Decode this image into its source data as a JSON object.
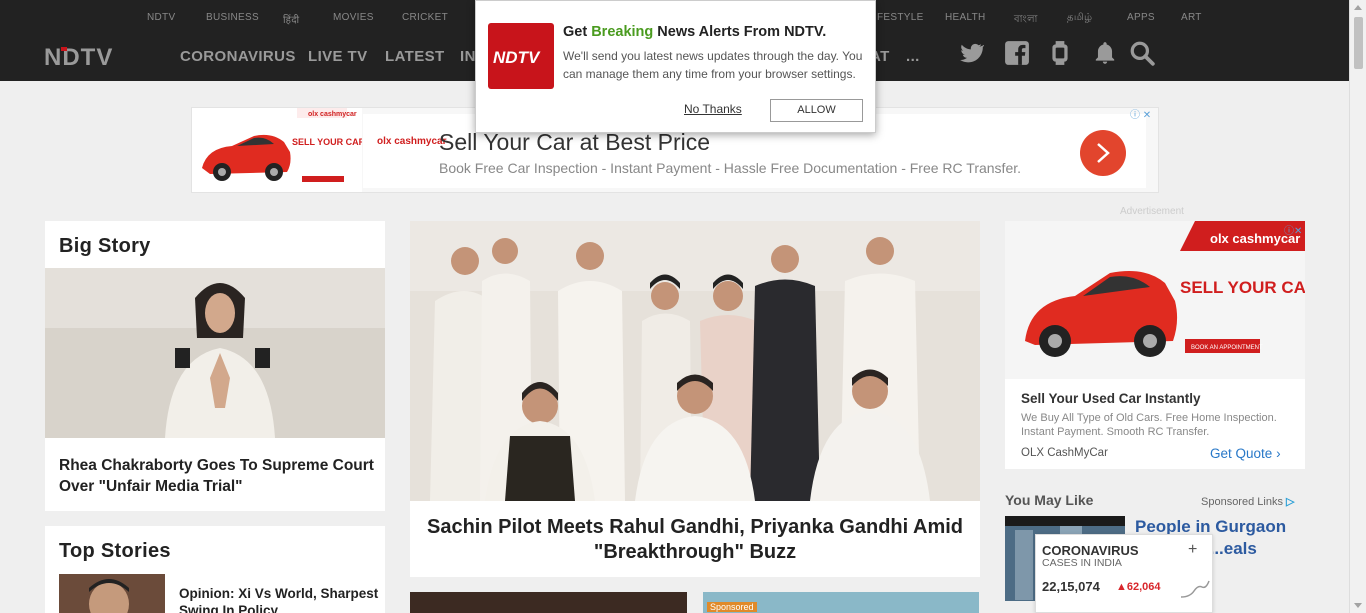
{
  "header": {
    "top_links": [
      "NDTV",
      "BUSINESS",
      "हिंदी",
      "MOVIES",
      "CRICKET",
      "FESTYLE",
      "HEALTH",
      "বাংলা",
      "தமிழ்",
      "APPS",
      "ART"
    ],
    "logo_text": "NDTV",
    "nav": [
      "CORONAVIRUS",
      "LIVE TV",
      "LATEST",
      "IN",
      "AT",
      "..."
    ]
  },
  "popup": {
    "title_pre": "Get ",
    "title_highlight": "Breaking",
    "title_post": " News Alerts From NDTV.",
    "body": "We'll send you latest news updates through the day. You can manage them any time from your browser settings.",
    "logo_text": "NDTV",
    "no_thanks": "No Thanks",
    "allow": "ALLOW"
  },
  "banner_ad": {
    "brand": "olx cashmycar",
    "car_tagline": "SELL YOUR CAR IN ONE VISIT.",
    "headline": "Sell Your Car at Best Price",
    "subline": "Book Free Car Inspection - Instant Payment - Hassle Free Documentation - Free RC Transfer."
  },
  "big_story": {
    "heading": "Big Story",
    "caption": "Rhea Chakraborty Goes To Supreme Court Over \"Unfair Media Trial\""
  },
  "lead_story": {
    "caption": "Sachin Pilot Meets Rahul Gandhi, Priyanka Gandhi Amid \"Breakthrough\" Buzz"
  },
  "top_stories": {
    "heading": "Top Stories",
    "first_item": "Opinion: Xi Vs World, Sharpest Swing In Policy"
  },
  "side_ad": {
    "advertisement_label": "Advertisement",
    "brand": "olx cashmycar",
    "car_tagline": "SELL YOUR CAR IN ONE VISIT.",
    "cta_small": "BOOK AN APPOINTMENT",
    "title": "Sell Your Used Car Instantly",
    "desc": "We Buy All Type of Old Cars. Free Home Inspection. Instant Payment. Smooth RC Transfer.",
    "advertiser": "OLX CashMyCar",
    "cta": "Get Quote"
  },
  "you_may_like": {
    "heading": "You May Like",
    "sponsored": "Sponsored Links",
    "title": "People in Gurgaon ...sing to ...eals Like..."
  },
  "corona_widget": {
    "title": "CORONAVIRUS",
    "subtitle": "CASES IN INDIA",
    "total": "22,15,074",
    "delta": "62,064"
  },
  "sponsored_tag": "Sponsored",
  "colors": {
    "header_bg": "#222222",
    "ndtv_red": "#c8141b",
    "breaking_green": "#4a9b1f",
    "link_blue": "#2878c8"
  }
}
